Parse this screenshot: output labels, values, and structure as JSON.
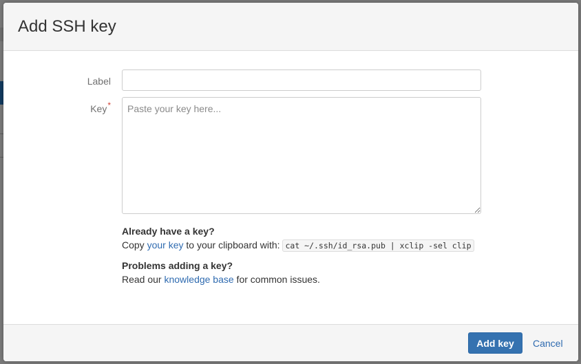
{
  "dialog": {
    "title": "Add SSH key"
  },
  "form": {
    "label_field": {
      "label": "Label",
      "value": "",
      "placeholder": ""
    },
    "key_field": {
      "label": "Key",
      "required_marker": "*",
      "value": "",
      "placeholder": "Paste your key here..."
    }
  },
  "help": {
    "have_key": {
      "heading": "Already have a key?",
      "text_before": "Copy ",
      "link_text": "your key",
      "text_after": " to your clipboard with: ",
      "command": "cat ~/.ssh/id_rsa.pub | xclip -sel clip"
    },
    "problems": {
      "heading": "Problems adding a key?",
      "text_before": "Read our ",
      "link_text": "knowledge base",
      "text_after": " for common issues."
    }
  },
  "footer": {
    "add_label": "Add key",
    "cancel_label": "Cancel"
  },
  "colors": {
    "primary": "#3572b0",
    "link": "#2f6bb0",
    "required": "#d04437"
  }
}
